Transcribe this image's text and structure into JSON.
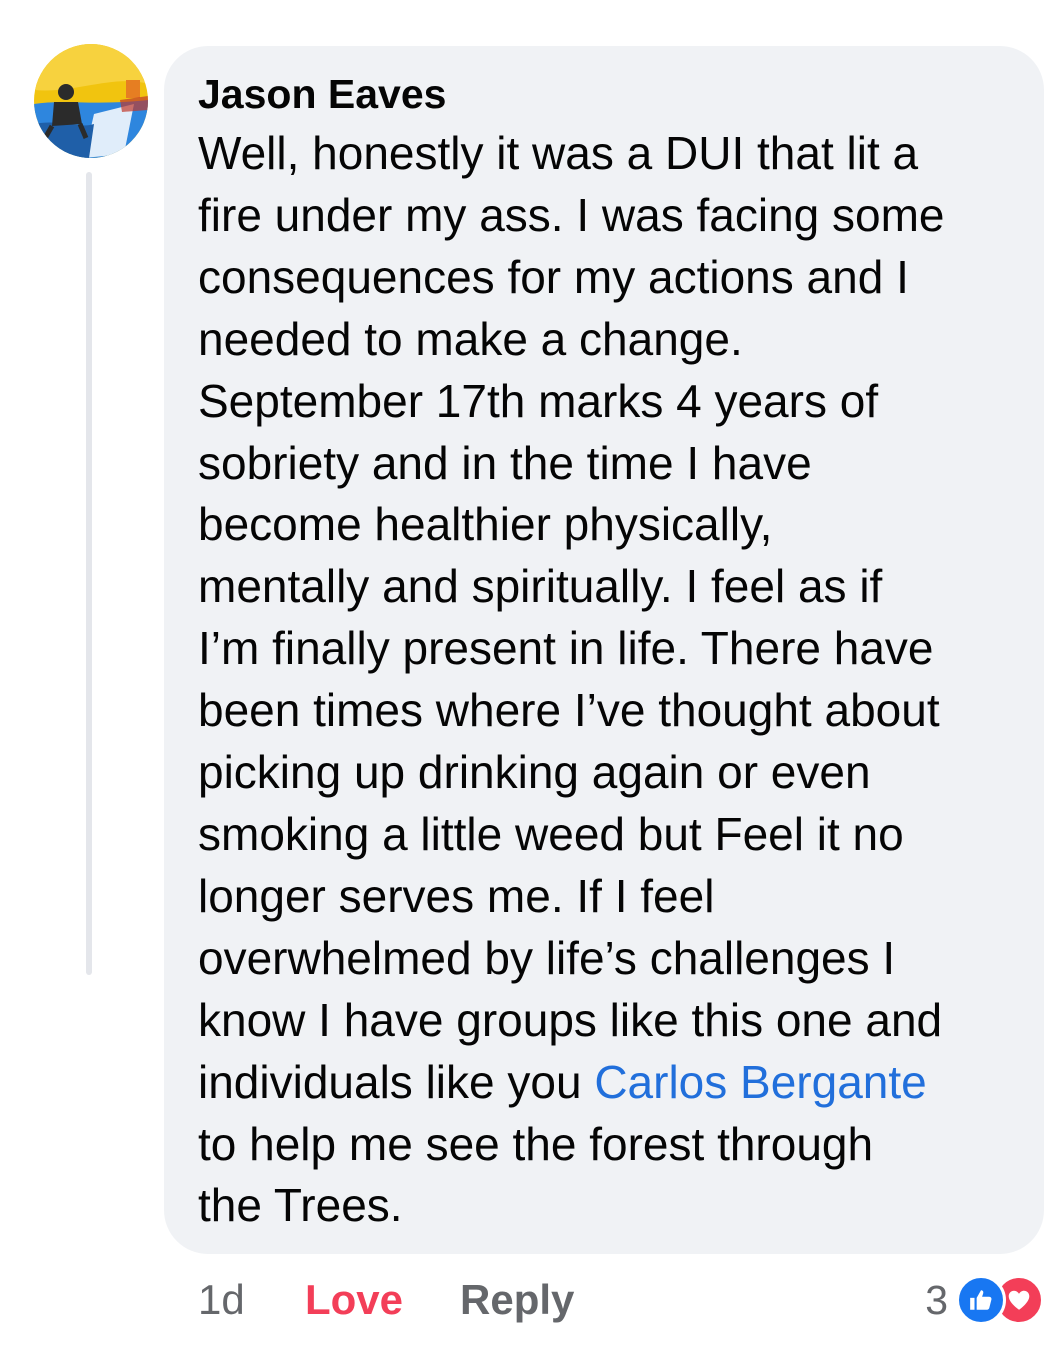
{
  "comment": {
    "author": "Jason Eaves",
    "lines": [
      "Well, honestly it was a DUI that lit a",
      "fire under my ass. I was facing some",
      "consequences for my actions and I",
      "needed to make a change.",
      "September 17th marks 4 years of",
      "sobriety and in the time I have",
      "become healthier physically,",
      "mentally and spiritually. I feel as if",
      "I’m finally present in life. There have",
      "been times where I’ve thought about",
      "picking up drinking again or even",
      "smoking a little weed but Feel it no",
      "longer serves me. If I feel",
      "overwhelmed by life’s challenges I",
      "know I have groups like this one and"
    ],
    "mention_prefix": "individuals like you ",
    "mention": "Carlos Bergante",
    "closing_lines": [
      "to help me see the forest through",
      "the Trees."
    ]
  },
  "actions": {
    "timestamp": "1d",
    "love_label": "Love",
    "reply_label": "Reply",
    "reaction_count": "3"
  },
  "icons": {
    "avatar": "avatar-photo",
    "like": "thumbs-up-icon",
    "love": "heart-icon"
  },
  "colors": {
    "bubble_bg": "#f0f2f5",
    "mention": "#216fdb",
    "love": "#f33e58",
    "like": "#1877f2",
    "muted": "#65676b"
  }
}
